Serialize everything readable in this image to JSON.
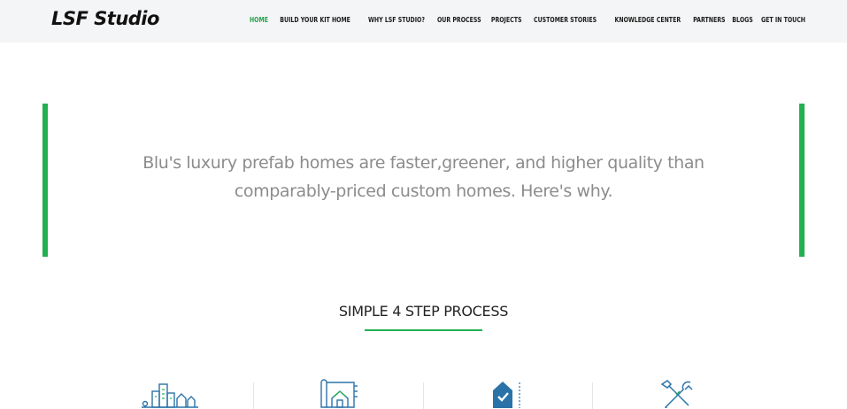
{
  "header": {
    "logo": "LSF Studio",
    "nav": [
      {
        "label": "HOME",
        "active": true
      },
      {
        "label": "BUILD YOUR KIT HOME",
        "active": false
      },
      {
        "label": "WHY LSF STUDIO?",
        "active": false
      },
      {
        "label": "OUR PROCESS",
        "active": false
      },
      {
        "label": "PROJECTS",
        "active": false
      },
      {
        "label": "CUSTOMER STORIES",
        "active": false
      },
      {
        "label": "KNOWLEDGE CENTER",
        "active": false
      },
      {
        "label": "PARTNERS",
        "active": false
      },
      {
        "label": "BLOGS",
        "active": false
      },
      {
        "label": "GET IN TOUCH",
        "active": false
      }
    ]
  },
  "hero": {
    "line1": "Blu's luxury prefab homes are faster,greener, and higher quality than",
    "line2": "comparably-priced custom homes. Here's why."
  },
  "process": {
    "title": "SIMPLE 4 STEP PROCESS",
    "steps": [
      {
        "icon": "city-buildings-icon"
      },
      {
        "icon": "blueprint-house-icon"
      },
      {
        "icon": "house-check-icon"
      },
      {
        "icon": "hammer-wrench-icon"
      }
    ]
  },
  "colors": {
    "accent": "#22b050",
    "nav_active": "#23a34a",
    "header_bg": "#f4f5f6",
    "hero_text": "#8c8c8c",
    "icon_blue": "#2a73a8"
  }
}
